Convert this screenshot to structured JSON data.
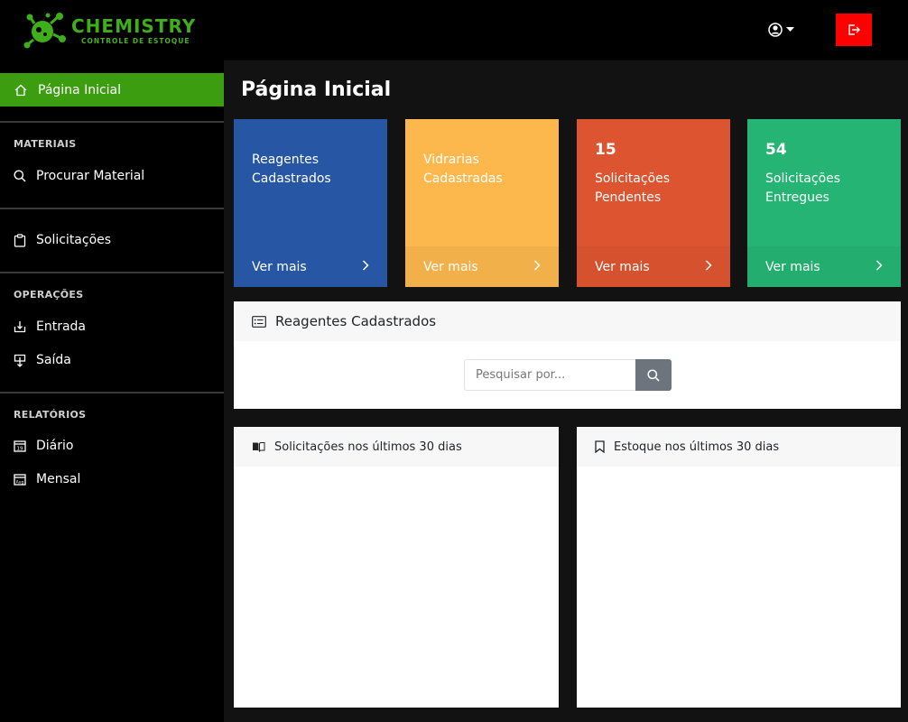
{
  "brand": {
    "title": "CHEMISTRY",
    "subtitle": "CONTROLE DE ESTOQUE",
    "color": "#3fae1b"
  },
  "header": {
    "user_icon": "user-circle-icon",
    "logout_icon": "logout-icon",
    "logout_color": "#ff0000"
  },
  "sidebar": {
    "home": {
      "label": "Página Inicial",
      "icon": "home-icon"
    },
    "sections": [
      {
        "title": "MATERIAIS",
        "items": [
          {
            "label": "Procurar Material",
            "icon": "search-icon"
          }
        ]
      },
      {
        "title": "",
        "items": [
          {
            "label": "Solicitações",
            "icon": "clipboard-icon"
          }
        ]
      },
      {
        "title": "OPERAÇÕES",
        "items": [
          {
            "label": "Entrada",
            "icon": "box-arrow-in-icon"
          },
          {
            "label": "Saída",
            "icon": "box-arrow-down-icon"
          }
        ]
      },
      {
        "title": "RELATÓRIOS",
        "items": [
          {
            "label": "Diário",
            "icon": "calendar-day-icon"
          },
          {
            "label": "Mensal",
            "icon": "calendar-month-icon"
          }
        ]
      }
    ]
  },
  "main": {
    "title": "Página Inicial",
    "cards": [
      {
        "number": "",
        "label": "Reagentes Cadastrados",
        "link": "Ver mais",
        "color": "#2656a4"
      },
      {
        "number": "",
        "label": "Vidrarias Cadastradas",
        "link": "Ver mais",
        "color": "#fcb84c"
      },
      {
        "number": "15",
        "label": "Solicitações Pendentes",
        "link": "Ver mais",
        "color": "#dc5530"
      },
      {
        "number": "54",
        "label": "Solicitações Entregues",
        "link": "Ver mais",
        "color": "#25b473"
      }
    ],
    "reagents_panel": {
      "title": "Reagentes Cadastrados",
      "icon": "card-list-icon",
      "search_placeholder": "Pesquisar por..."
    },
    "requests_panel": {
      "title": "Solicitações nos últimos 30 dias",
      "icon": "book-icon"
    },
    "stock_panel": {
      "title": "Estoque nos últimos 30 dias",
      "icon": "bookmark-icon"
    }
  }
}
